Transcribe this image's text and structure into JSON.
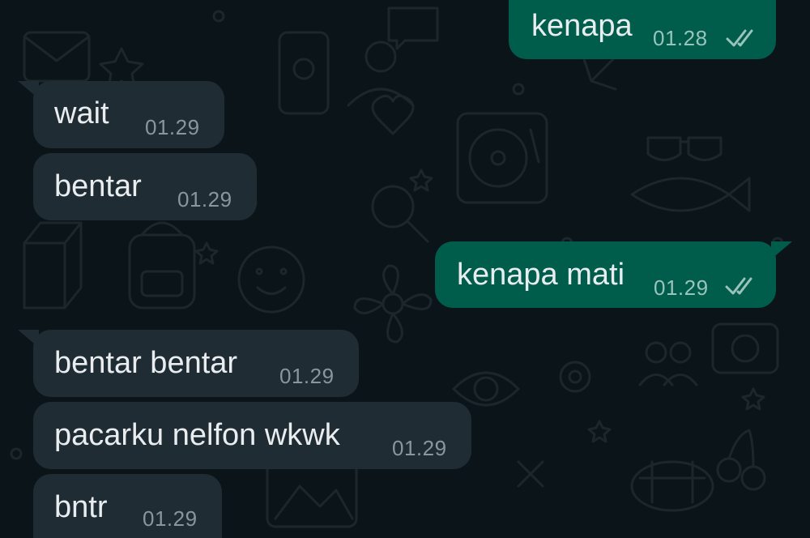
{
  "colors": {
    "background": "#0b1418",
    "incoming_bubble": "#202c33",
    "outgoing_bubble": "#005c4b",
    "text": "#e9edef",
    "incoming_time": "#8a969c",
    "outgoing_time": "#99c4bb",
    "read_ticks": "#99c4bb"
  },
  "messages": [
    {
      "direction": "outgoing",
      "text": "kenapa",
      "time": "01.28",
      "status_icon": "double-check-icon"
    },
    {
      "direction": "incoming",
      "text": "wait",
      "time": "01.29"
    },
    {
      "direction": "incoming",
      "text": "bentar",
      "time": "01.29"
    },
    {
      "direction": "outgoing",
      "text": "kenapa mati",
      "time": "01.29",
      "status_icon": "double-check-icon"
    },
    {
      "direction": "incoming",
      "text": "bentar bentar",
      "time": "01.29"
    },
    {
      "direction": "incoming",
      "text": "pacarku nelfon wkwk",
      "time": "01.29"
    },
    {
      "direction": "incoming",
      "text": "bntr",
      "time": "01.29"
    }
  ]
}
